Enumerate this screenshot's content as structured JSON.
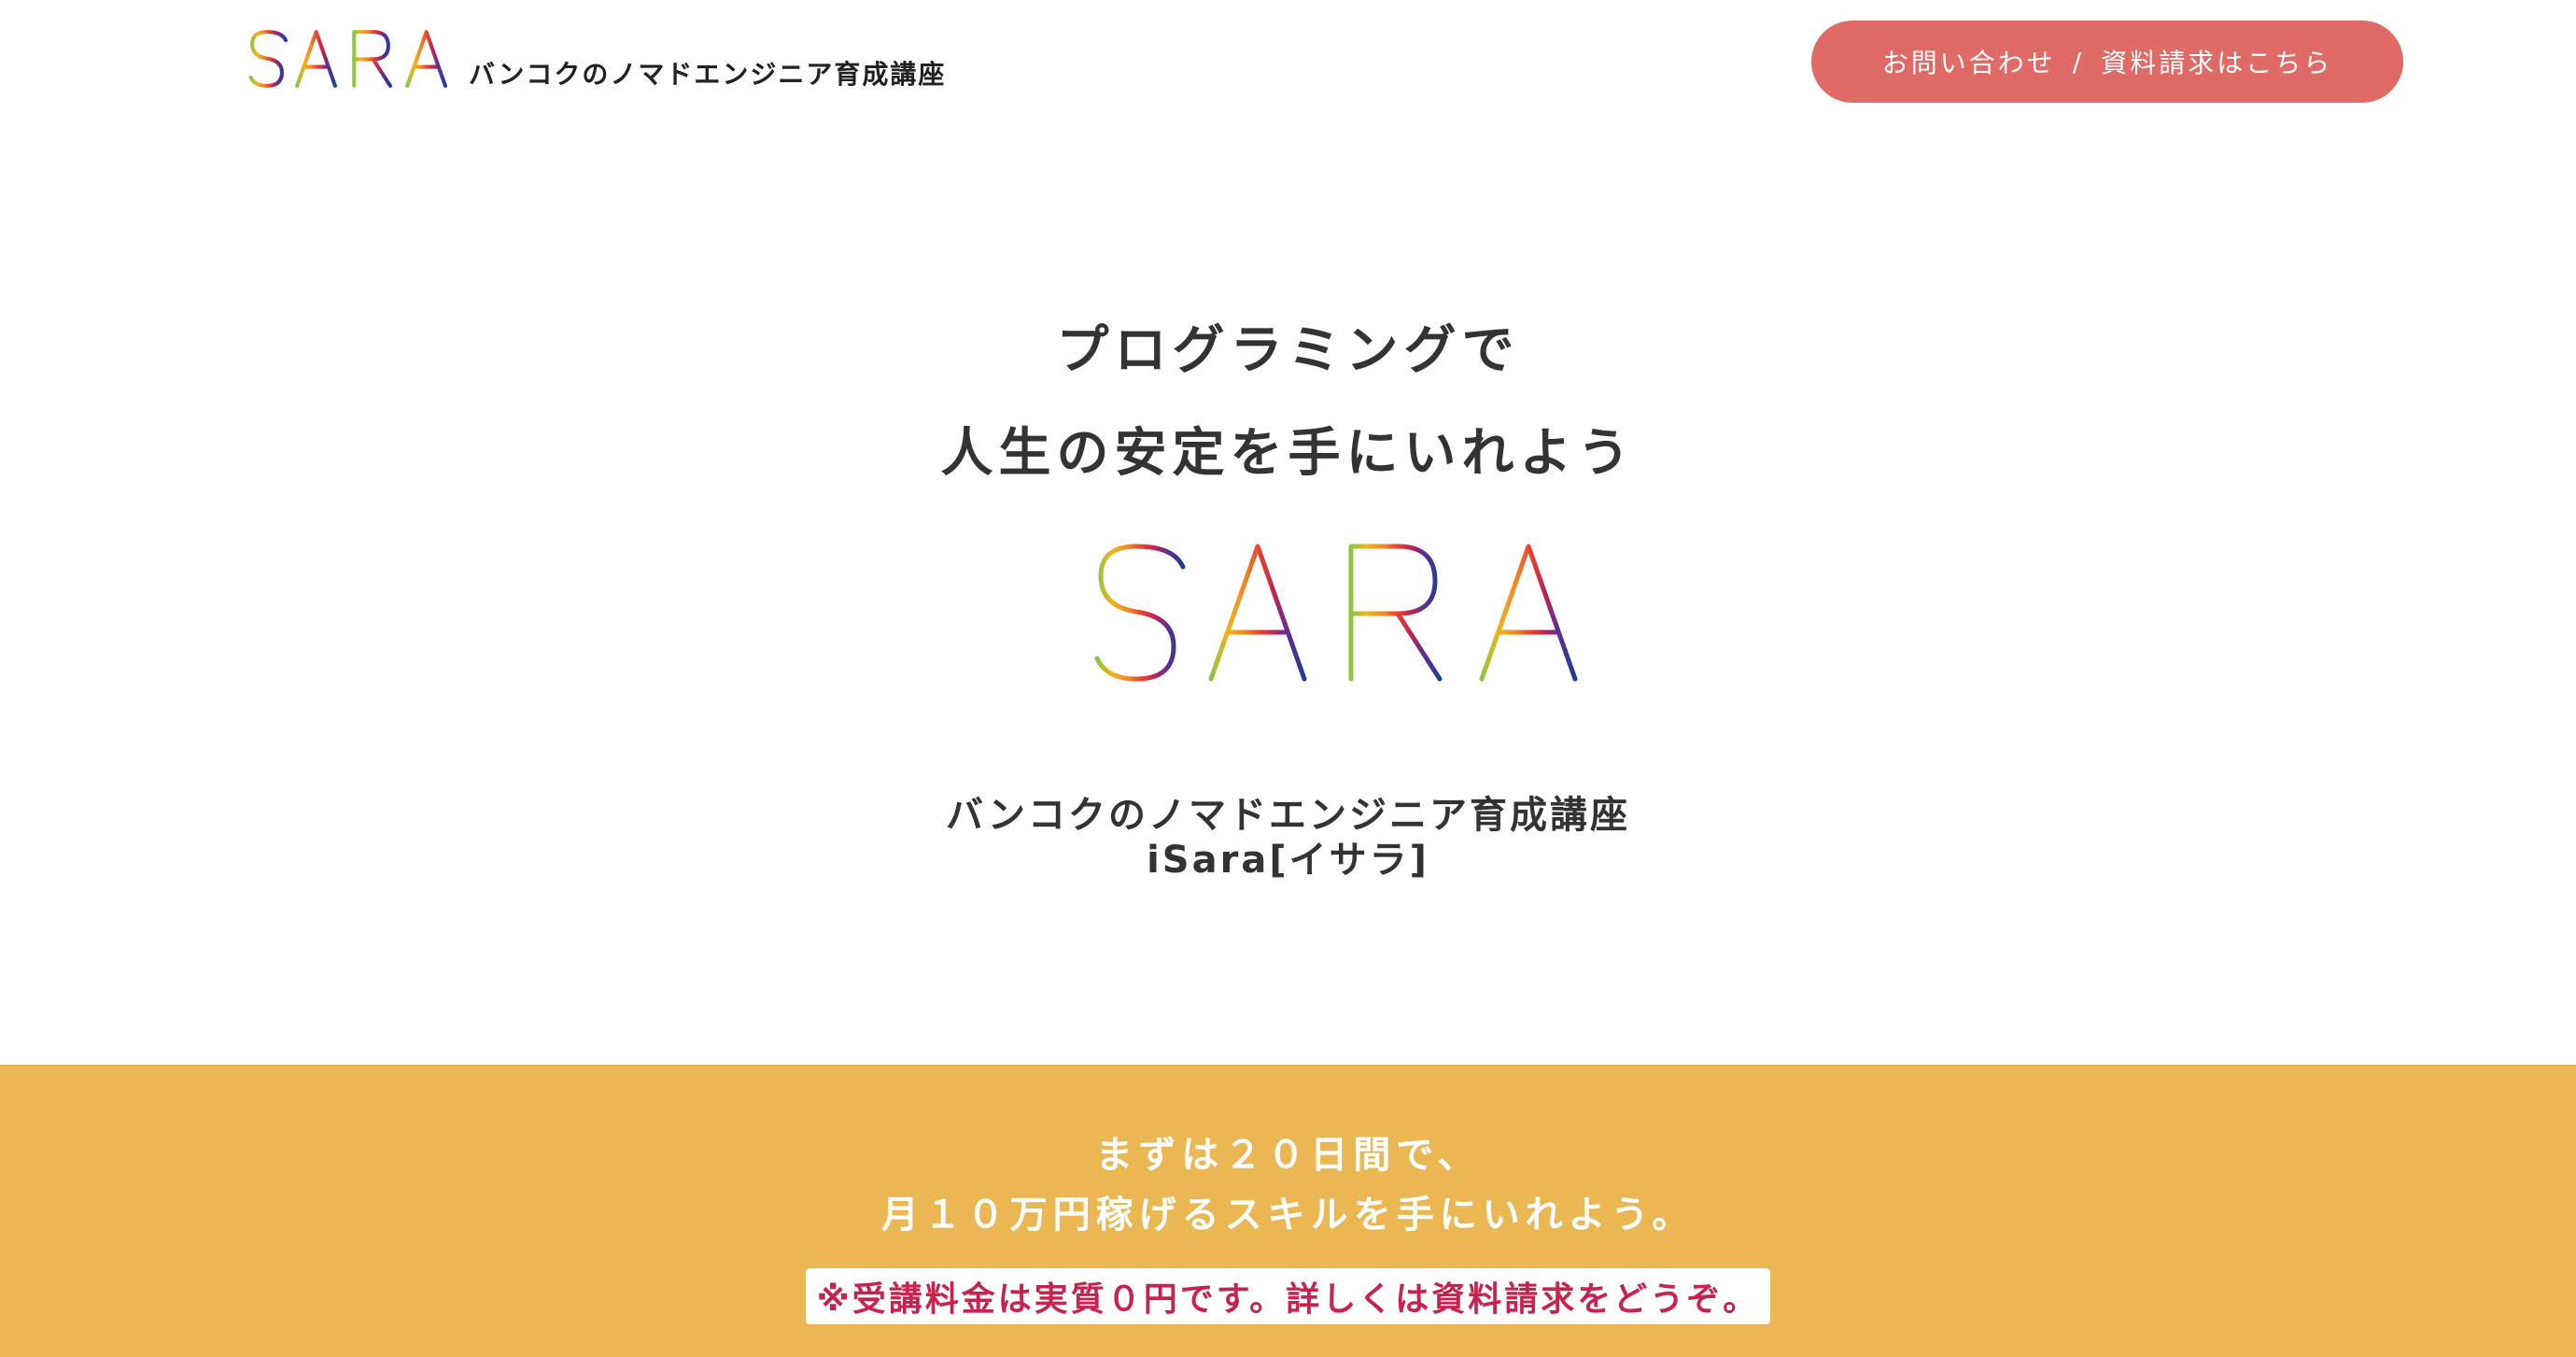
{
  "header": {
    "logo_text": "iSARA",
    "tagline": "バンコクのノマドエンジニア育成講座",
    "cta": {
      "part1": "お問い合わせ",
      "separator": "/",
      "part2": "資料請求はこちら",
      "color": "#e06b66"
    }
  },
  "hero": {
    "headline_line1": "プログラミングで",
    "headline_line2": "人生の安定を手にいれよう",
    "logo_text": "iSARA",
    "sub_line1": "バンコクのノマドエンジニア育成講座",
    "sub_line2": "iSara[イサラ]"
  },
  "banner": {
    "line1": "まずは２０日間で、",
    "line2": "月１０万円稼げるスキルを手にいれよう。",
    "note": "※受講料金は実質０円です。詳しくは資料請求をどうぞ。",
    "background": "#ebb752",
    "note_color": "#c8234e"
  }
}
